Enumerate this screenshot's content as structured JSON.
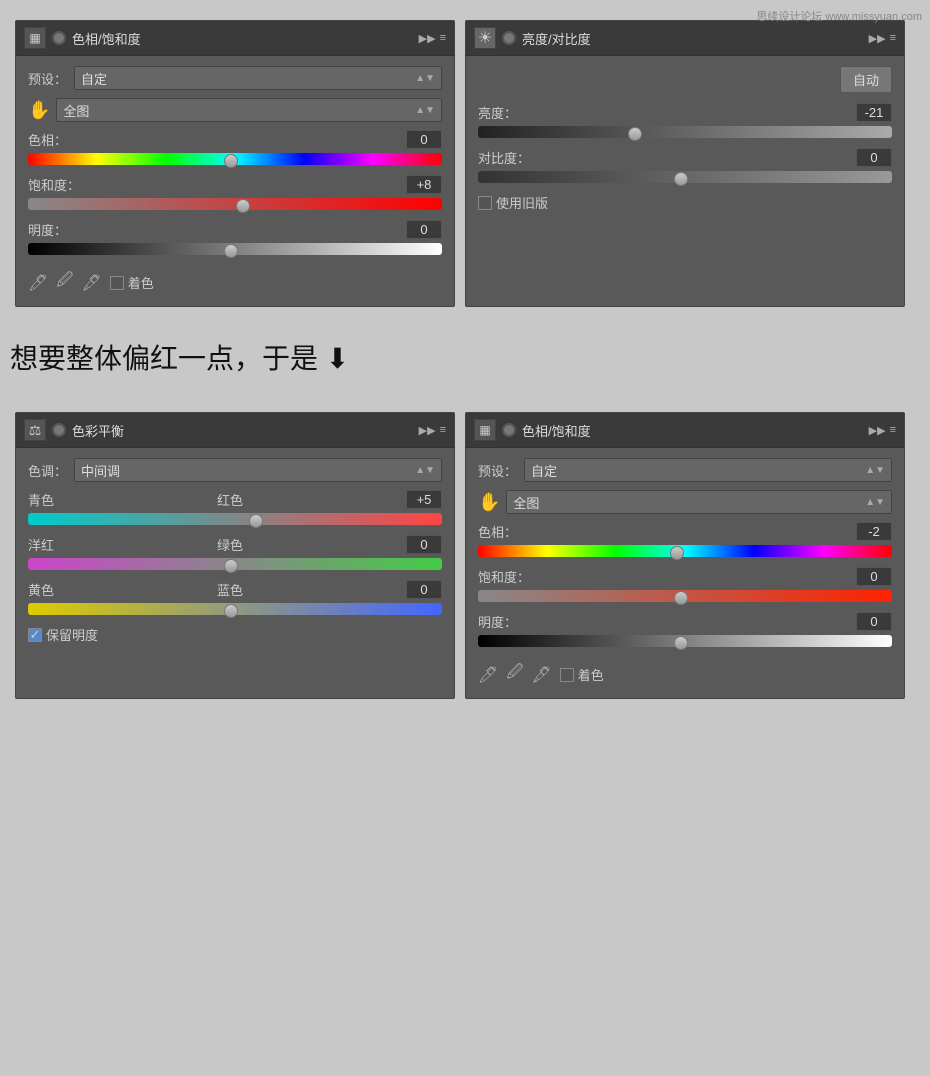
{
  "watermark": "思续设计论坛 www.missyuan.com",
  "mid_text": "想要整体偏红一点，于是",
  "panels": {
    "panel1": {
      "title": "色相/饱和度",
      "preset_label": "预设：",
      "preset_value": "自定",
      "channel_value": "全图",
      "hue_label": "色相：",
      "hue_value": "0",
      "hue_thumb_pos": "49",
      "sat_label": "饱和度：",
      "sat_value": "+8",
      "sat_thumb_pos": "52",
      "light_label": "明度：",
      "light_value": "0",
      "light_thumb_pos": "49",
      "colorize_label": "着色"
    },
    "panel2": {
      "title": "亮度/对比度",
      "auto_label": "自动",
      "brightness_label": "亮度：",
      "brightness_value": "-21",
      "brightness_thumb_pos": "38",
      "contrast_label": "对比度：",
      "contrast_value": "0",
      "contrast_thumb_pos": "49",
      "legacy_label": "使用旧版"
    },
    "panel3": {
      "title": "色彩平衡",
      "tone_label": "色调：",
      "tone_value": "中间调",
      "cyan_label": "青色",
      "red_label": "红色",
      "cyan_red_value": "+5",
      "cyan_red_thumb_pos": "55",
      "magenta_label": "洋红",
      "green_label": "绿色",
      "magenta_green_value": "0",
      "magenta_green_thumb_pos": "49",
      "yellow_label": "黄色",
      "blue_label": "蓝色",
      "yellow_blue_value": "0",
      "yellow_blue_thumb_pos": "49",
      "preserve_label": "保留明度",
      "preserve_checked": true
    },
    "panel4": {
      "title": "色相/饱和度",
      "preset_label": "预设：",
      "preset_value": "自定",
      "channel_value": "全图",
      "hue_label": "色相：",
      "hue_value": "-2",
      "hue_thumb_pos": "48",
      "sat_label": "饱和度：",
      "sat_value": "0",
      "sat_thumb_pos": "49",
      "light_label": "明度：",
      "light_value": "0",
      "light_thumb_pos": "49",
      "colorize_label": "着色"
    }
  }
}
